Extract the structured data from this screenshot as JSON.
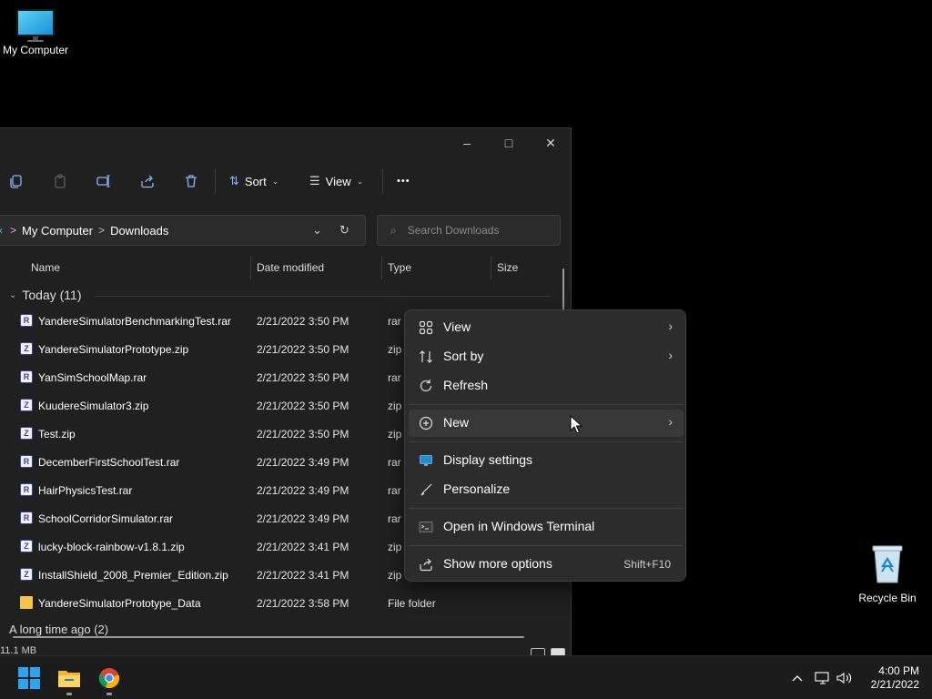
{
  "desktop": {
    "my_computer_label": "My Computer",
    "recycle_bin_label": "Recycle Bin"
  },
  "explorer": {
    "window_controls": {
      "minimize": "–",
      "maximize": "□",
      "close": "✕"
    },
    "toolbar": {
      "sort_label": "Sort",
      "view_label": "View",
      "more_label": "•••"
    },
    "address": {
      "crumbs": [
        "My Computer",
        "Downloads"
      ],
      "separator": ">"
    },
    "search": {
      "placeholder": "Search Downloads"
    },
    "columns": {
      "name": "Name",
      "date": "Date modified",
      "type": "Type",
      "size": "Size"
    },
    "group_today": "Today (11)",
    "group_long_ago": "A long time ago (2)",
    "files": [
      {
        "name": "YandereSimulatorBenchmarkingTest.rar",
        "date": "2/21/2022 3:50 PM",
        "type": "rar",
        "kind": "rar"
      },
      {
        "name": "YandereSimulatorPrototype.zip",
        "date": "2/21/2022 3:50 PM",
        "type": "zip",
        "kind": "zip"
      },
      {
        "name": "YanSimSchoolMap.rar",
        "date": "2/21/2022 3:50 PM",
        "type": "rar",
        "kind": "rar"
      },
      {
        "name": "KuudereSimulator3.zip",
        "date": "2/21/2022 3:50 PM",
        "type": "zip",
        "kind": "zip"
      },
      {
        "name": "Test.zip",
        "date": "2/21/2022 3:50 PM",
        "type": "zip",
        "kind": "zip"
      },
      {
        "name": "DecemberFirstSchoolTest.rar",
        "date": "2/21/2022 3:49 PM",
        "type": "rar",
        "kind": "rar"
      },
      {
        "name": "HairPhysicsTest.rar",
        "date": "2/21/2022 3:49 PM",
        "type": "rar",
        "kind": "rar"
      },
      {
        "name": "SchoolCorridorSimulator.rar",
        "date": "2/21/2022 3:49 PM",
        "type": "rar",
        "kind": "rar"
      },
      {
        "name": "lucky-block-rainbow-v1.8.1.zip",
        "date": "2/21/2022 3:41 PM",
        "type": "zip",
        "kind": "zip"
      },
      {
        "name": "InstallShield_2008_Premier_Edition.zip",
        "date": "2/21/2022 3:41 PM",
        "type": "zip",
        "kind": "zip"
      },
      {
        "name": "YandereSimulatorPrototype_Data",
        "date": "2/21/2022 3:58 PM",
        "type": "File folder",
        "kind": "folder"
      }
    ],
    "status": "11.1 MB"
  },
  "context_menu": {
    "items": [
      {
        "label": "View",
        "icon": "grid-icon",
        "submenu": true
      },
      {
        "label": "Sort by",
        "icon": "sort-icon",
        "submenu": true
      },
      {
        "label": "Refresh",
        "icon": "refresh-icon",
        "submenu": false
      },
      {
        "label": "New",
        "icon": "plus-circle-icon",
        "submenu": true
      },
      {
        "label": "Display settings",
        "icon": "display-icon",
        "submenu": false
      },
      {
        "label": "Personalize",
        "icon": "brush-icon",
        "submenu": false
      },
      {
        "label": "Open in Windows Terminal",
        "icon": "terminal-icon",
        "submenu": false
      },
      {
        "label": "Show more options",
        "icon": "share-icon",
        "submenu": false,
        "shortcut": "Shift+F10"
      }
    ]
  },
  "taskbar": {
    "clock_time": "4:00 PM",
    "clock_date": "2/21/2022"
  },
  "colors": {
    "accent": "#4cc2ff",
    "folder": "#f5c44b",
    "window_bg": "#202020",
    "menu_bg": "#2c2c2c",
    "taskbar_bg": "#1c1c1c"
  }
}
